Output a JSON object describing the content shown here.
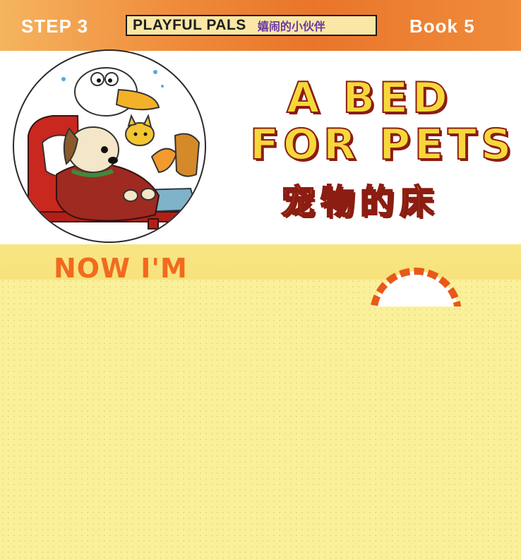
{
  "header": {
    "step_label": "STEP 3",
    "series_en": "PLAYFUL PALS",
    "series_zh": "嬉闹的小伙伴",
    "book_label": "Book 5"
  },
  "title": {
    "line1": "A BED",
    "line2": "FOR PETS",
    "zh": "宠物的床"
  },
  "level_banner": {
    "text": "NOW I'M"
  },
  "colors": {
    "header_orange": "#e9752a",
    "title_yellow": "#f6d83a",
    "title_outline": "#8b1d12",
    "band_yellow": "#fbf09a",
    "banner_orange": "#f26a1e"
  }
}
